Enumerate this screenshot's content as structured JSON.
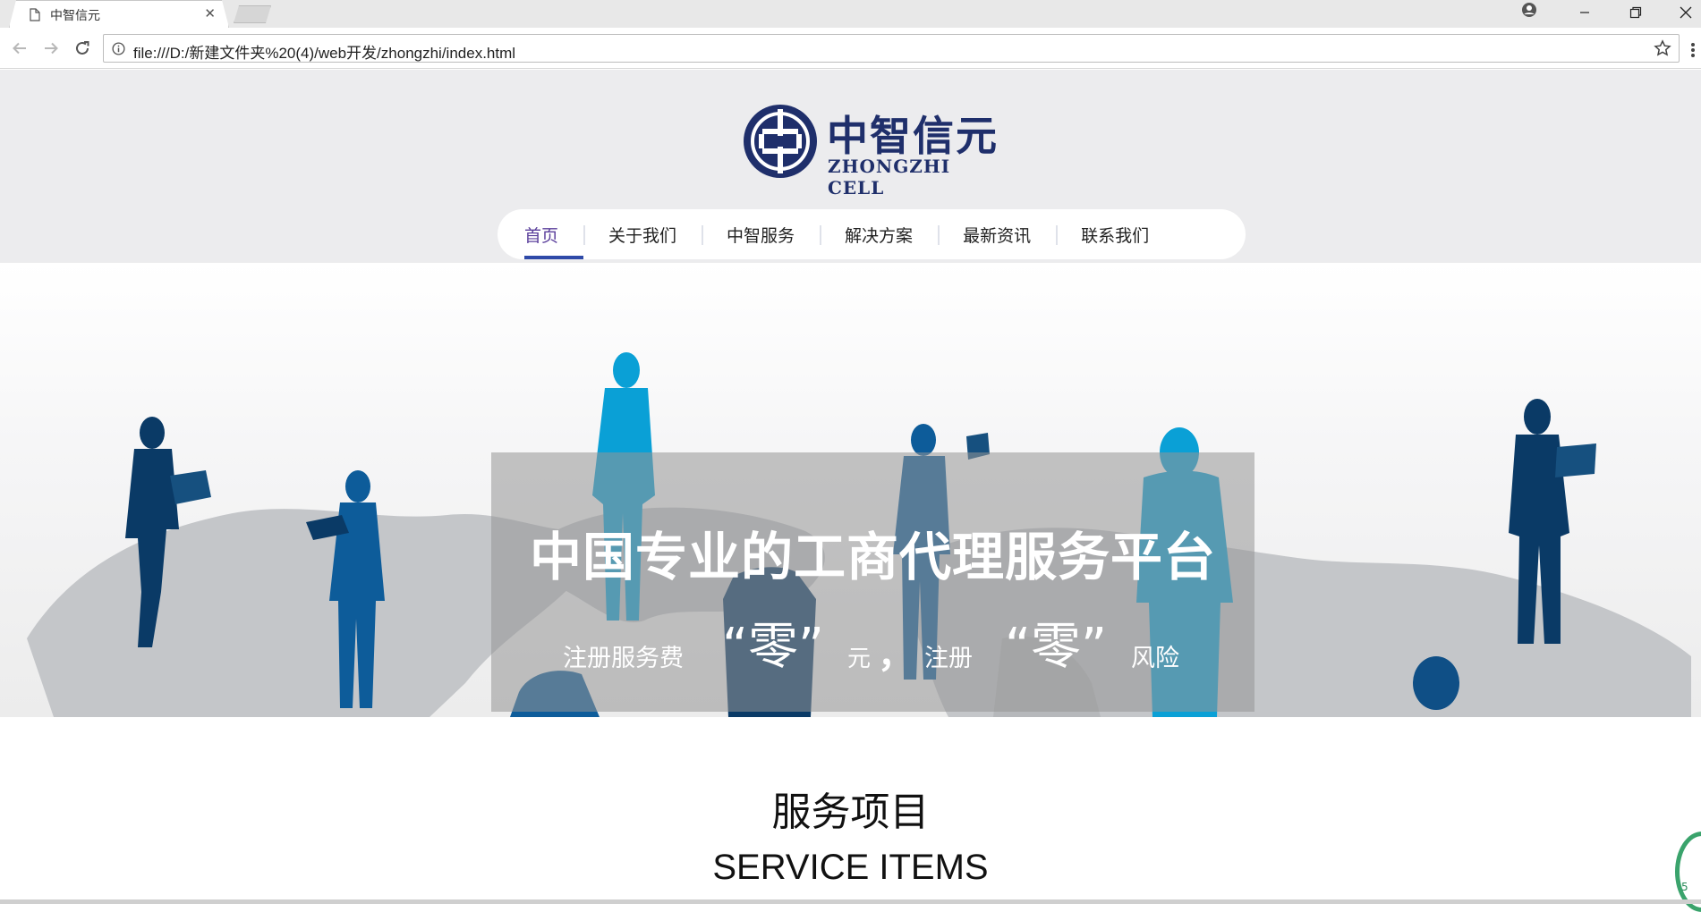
{
  "browser": {
    "tab_title": "中智信元",
    "url": "file:///D:/新建文件夹%20(4)/web开发/zhongzhi/index.html"
  },
  "logo": {
    "name_cn": "中智信元",
    "name_en": "ZHONGZHI CELL",
    "color": "#1f2f6b"
  },
  "nav": {
    "items": [
      {
        "label": "首页",
        "active": true
      },
      {
        "label": "关于我们"
      },
      {
        "label": "中智服务"
      },
      {
        "label": "解决方案"
      },
      {
        "label": "最新资讯"
      },
      {
        "label": "联系我们"
      }
    ],
    "active_color": "#5a3e9b",
    "indicator_color": "#2f4aa8"
  },
  "banner": {
    "headline": "中国专业的工商代理服务平台",
    "slogan": {
      "part1": "注册服务费",
      "zero1": "“零”",
      "part2": "元",
      "comma": "，",
      "part3": "注册",
      "zero2": "“零”",
      "part4": "风险"
    }
  },
  "services": {
    "title_cn": "服务项目",
    "title_en": "SERVICE ITEMS"
  },
  "widget": {
    "text": "5"
  }
}
